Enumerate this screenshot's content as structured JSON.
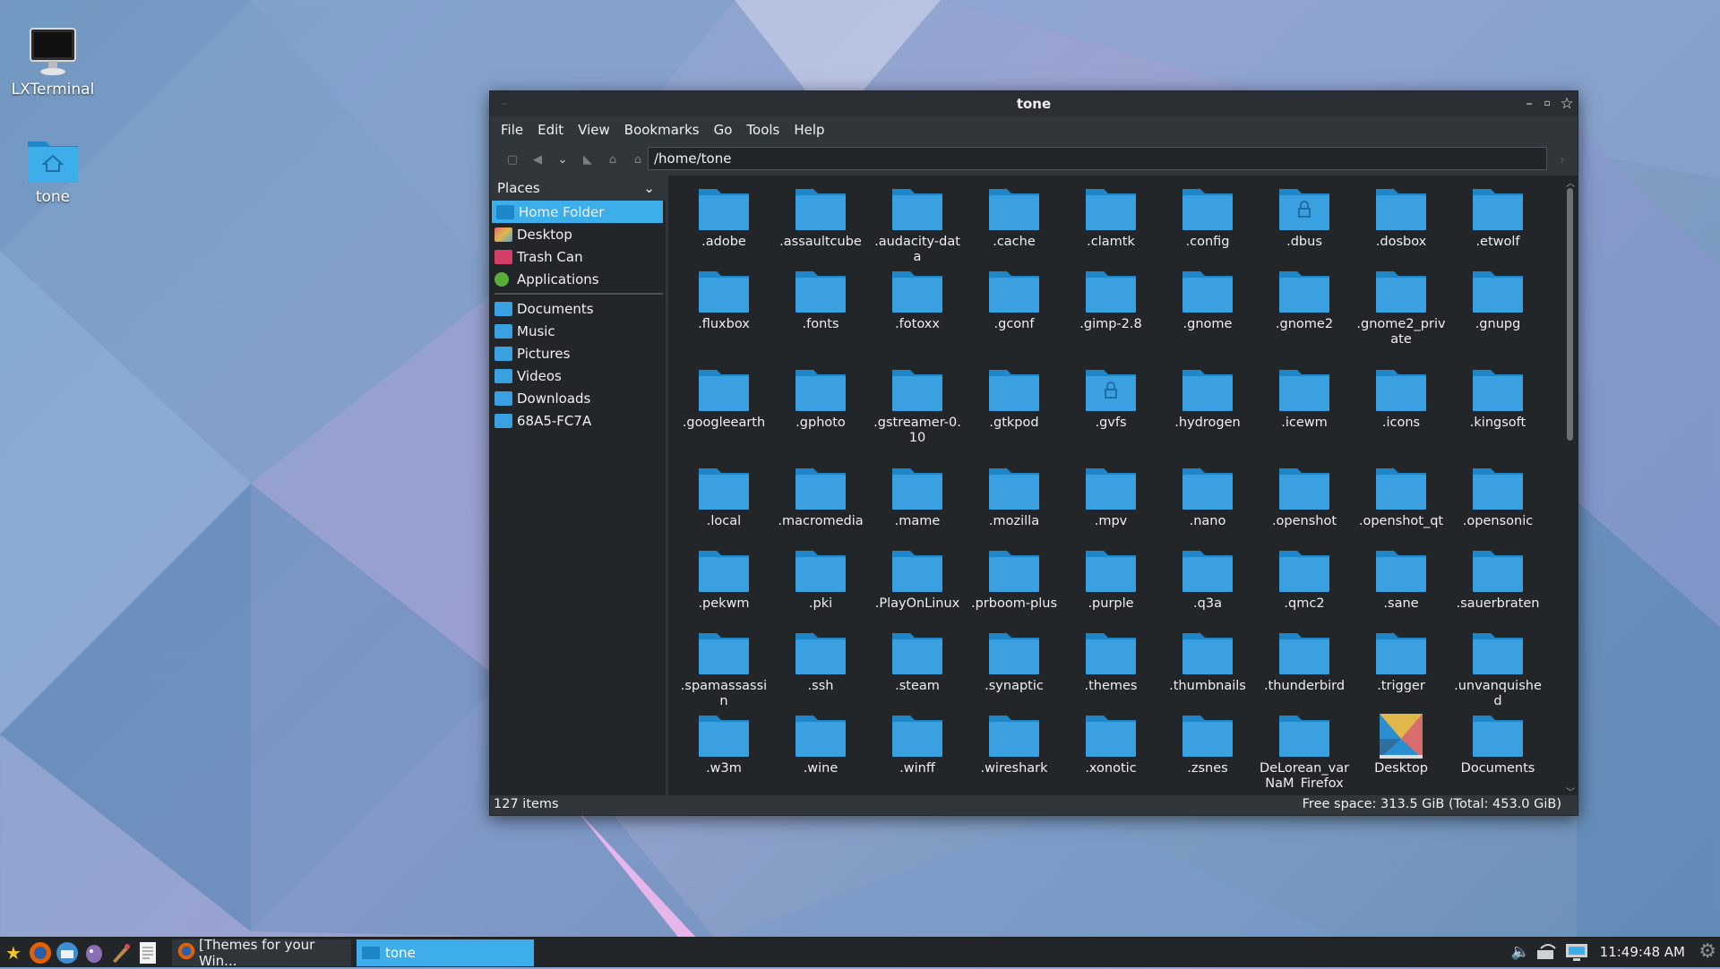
{
  "desktop": {
    "icons": [
      {
        "label": "LXTerminal",
        "icon": "monitor-icon"
      },
      {
        "label": "tone",
        "icon": "home-folder-icon"
      }
    ]
  },
  "window": {
    "title": "tone",
    "menu": [
      "File",
      "Edit",
      "View",
      "Bookmarks",
      "Go",
      "Tools",
      "Help"
    ],
    "path": "/home/tone",
    "places_label": "Places",
    "places": [
      {
        "label": "Home Folder",
        "selected": true,
        "color": "#3daee9"
      },
      {
        "label": "Desktop",
        "color": "#d0ad4a"
      },
      {
        "label": "Trash Can",
        "color": "#d63e6a"
      },
      {
        "label": "Applications",
        "color": "#5aae3a"
      }
    ],
    "bookmarks": [
      "Documents",
      "Music",
      "Pictures",
      "Videos",
      "Downloads",
      "68A5-FC7A"
    ],
    "files": [
      {
        "name": ".adobe"
      },
      {
        "name": ".assaultcube"
      },
      {
        "name": ".audacity-data"
      },
      {
        "name": ".cache"
      },
      {
        "name": ".clamtk"
      },
      {
        "name": ".config"
      },
      {
        "name": ".dbus",
        "locked": true
      },
      {
        "name": ".dosbox"
      },
      {
        "name": ".etwolf"
      },
      {
        "name": ".fluxbox"
      },
      {
        "name": ".fonts"
      },
      {
        "name": ".fotoxx"
      },
      {
        "name": ".gconf"
      },
      {
        "name": ".gimp-2.8"
      },
      {
        "name": ".gnome"
      },
      {
        "name": ".gnome2"
      },
      {
        "name": ".gnome2_private"
      },
      {
        "name": ".gnupg"
      },
      {
        "name": ".googleearth"
      },
      {
        "name": ".gphoto"
      },
      {
        "name": ".gstreamer-0.10"
      },
      {
        "name": ".gtkpod"
      },
      {
        "name": ".gvfs",
        "locked": true
      },
      {
        "name": ".hydrogen"
      },
      {
        "name": ".icewm"
      },
      {
        "name": ".icons"
      },
      {
        "name": ".kingsoft"
      },
      {
        "name": ".local"
      },
      {
        "name": ".macromedia"
      },
      {
        "name": ".mame"
      },
      {
        "name": ".mozilla"
      },
      {
        "name": ".mpv"
      },
      {
        "name": ".nano"
      },
      {
        "name": ".openshot"
      },
      {
        "name": ".openshot_qt"
      },
      {
        "name": ".opensonic"
      },
      {
        "name": ".pekwm"
      },
      {
        "name": ".pki"
      },
      {
        "name": ".PlayOnLinux"
      },
      {
        "name": ".prboom-plus"
      },
      {
        "name": ".purple"
      },
      {
        "name": ".q3a"
      },
      {
        "name": ".qmc2"
      },
      {
        "name": ".sane"
      },
      {
        "name": ".sauerbraten"
      },
      {
        "name": ".spamassassin"
      },
      {
        "name": ".ssh"
      },
      {
        "name": ".steam"
      },
      {
        "name": ".synaptic"
      },
      {
        "name": ".themes"
      },
      {
        "name": ".thumbnails"
      },
      {
        "name": ".thunderbird"
      },
      {
        "name": ".trigger"
      },
      {
        "name": ".unvanquished"
      },
      {
        "name": ".w3m"
      },
      {
        "name": ".wine"
      },
      {
        "name": ".winff"
      },
      {
        "name": ".wireshark"
      },
      {
        "name": ".xonotic"
      },
      {
        "name": ".zsnes"
      },
      {
        "name": "DeLorean_varNaM_Firefox"
      },
      {
        "name": "Desktop",
        "special": "desktop"
      },
      {
        "name": "Documents"
      }
    ],
    "status_items": "127 items",
    "status_free": "Free space: 313.5 GiB (Total: 453.0 GiB)"
  },
  "taskbar": {
    "tasks": [
      {
        "label": "[Themes for your Win...",
        "icon": "firefox-icon",
        "active": false
      },
      {
        "label": "tone",
        "icon": "folder-icon",
        "active": true
      }
    ],
    "clock": "11:49:48 AM"
  },
  "colors": {
    "accent": "#3daee9",
    "folder": "#3aa0e0",
    "folder_tab": "#1d87c9"
  }
}
